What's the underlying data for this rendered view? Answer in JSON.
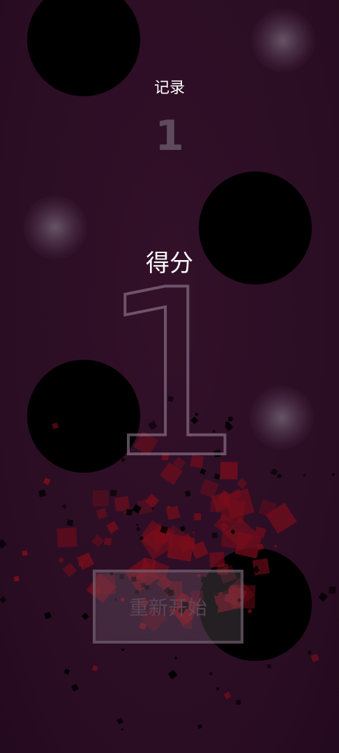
{
  "game": {
    "record_label": "记录",
    "record_value": "1",
    "score_label": "得分",
    "score_value": "1",
    "restart_label": "重新开始"
  },
  "colors": {
    "background": "#2d0f26",
    "orb": "#000000",
    "debris_red": "#7a0d1a",
    "debris_dark": "#000000"
  }
}
